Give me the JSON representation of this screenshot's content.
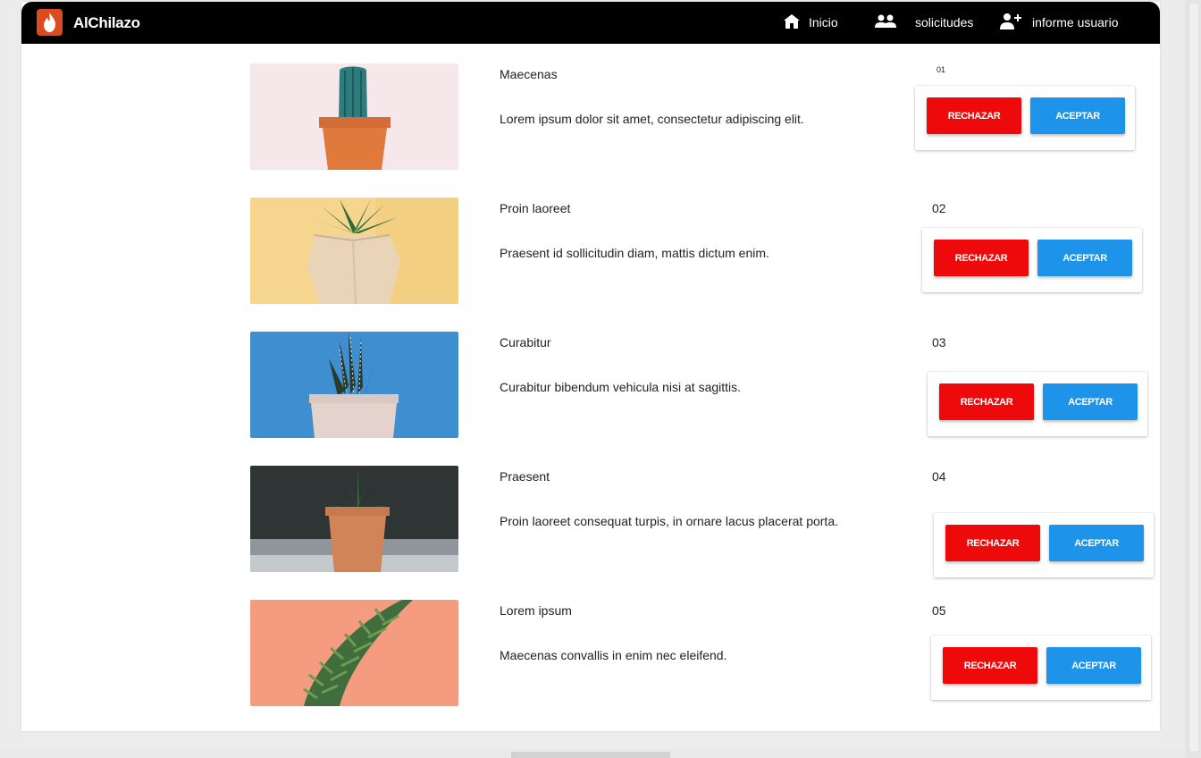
{
  "app": {
    "brand": "AlChilazo"
  },
  "nav": {
    "inicio": "Inicio",
    "solicitudes": "solicitudes",
    "informe": "informe usuario"
  },
  "buttons": {
    "reject": "RECHAZAR",
    "accept": "ACEPTAR"
  },
  "items": [
    {
      "title": "Maecenas",
      "description": "Lorem ipsum dolor sit amet, consectetur adipiscing elit.",
      "number": "01"
    },
    {
      "title": "Proin laoreet",
      "description": "Praesent id sollicitudin diam, mattis dictum enim.",
      "number": "02"
    },
    {
      "title": "Curabitur",
      "description": "Curabitur bibendum vehicula nisi at sagittis.",
      "number": "03"
    },
    {
      "title": "Praesent",
      "description": "Proin laoreet consequat turpis, in ornare lacus placerat porta.",
      "number": "04"
    },
    {
      "title": "Lorem ipsum",
      "description": "Maecenas convallis in enim nec eleifend.",
      "number": "05"
    }
  ],
  "colors": {
    "navbar": "#000000",
    "brand_accent": "#dc4a1f",
    "reject": "#ee0a0a",
    "accept": "#1d94ea"
  }
}
